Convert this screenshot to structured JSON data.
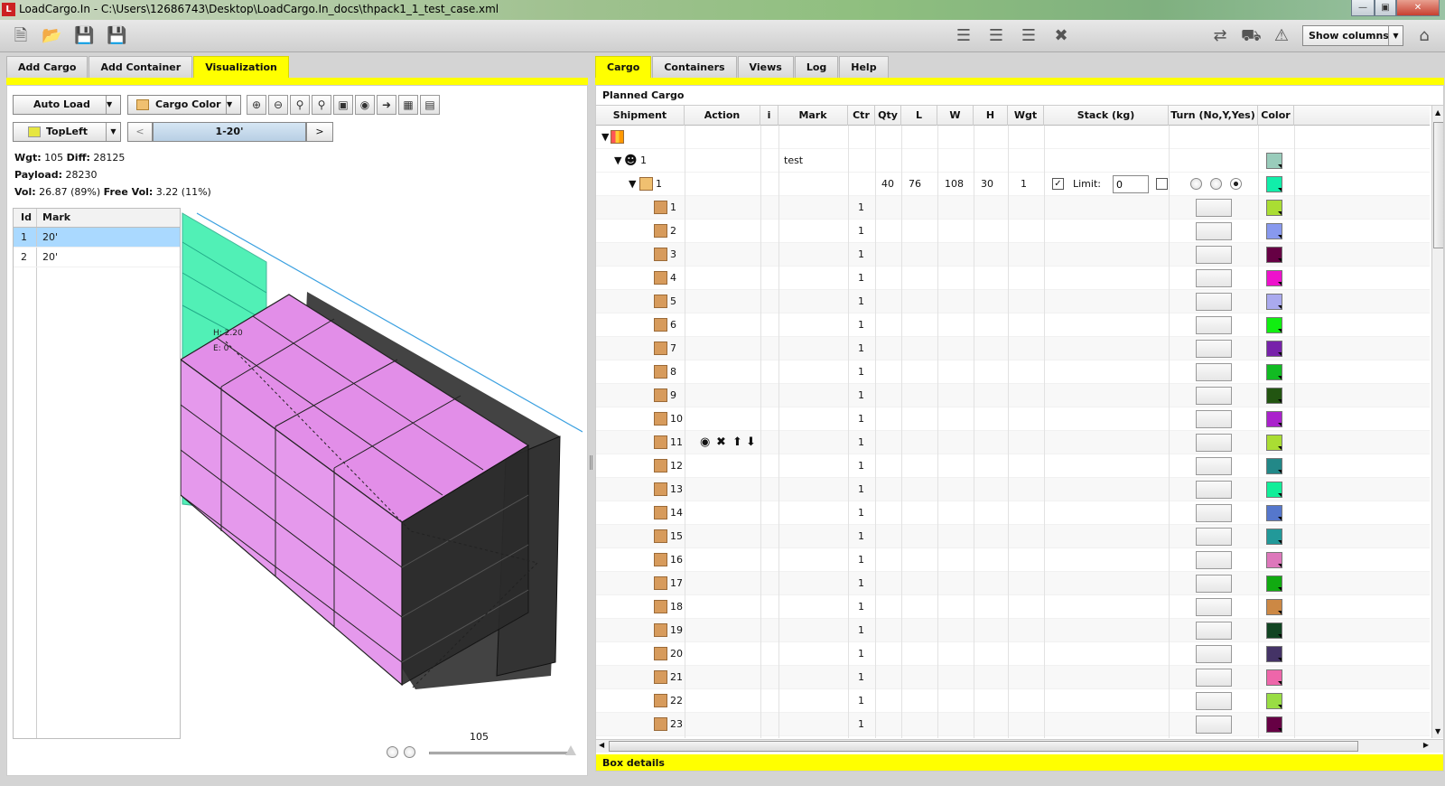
{
  "window": {
    "title": "LoadCargo.In - C:\\Users\\12686743\\Desktop\\LoadCargo.In_docs\\thpack1_1_test_case.xml",
    "app_icon": "L"
  },
  "toolbar": {
    "show_columns_label": "Show columns"
  },
  "left_tabs": [
    "Add Cargo",
    "Add Container",
    "Visualization"
  ],
  "right_tabs": [
    "Cargo",
    "Containers",
    "Views",
    "Log",
    "Help"
  ],
  "viz": {
    "auto_load_label": "Auto Load",
    "cargo_color_label": "Cargo Color",
    "view_label": "TopLeft",
    "prev_label": "<",
    "next_label": ">",
    "range_label": "1-20'",
    "wgt_label": "Wgt:",
    "wgt_value": "105",
    "diff_label": "Diff:",
    "diff_value": "28125",
    "payload_label": "Payload:",
    "payload_value": "28230",
    "vol_label": "Vol:",
    "vol_value": "26.87 (89%)",
    "free_vol_label": "Free Vol:",
    "free_vol_value": "3.22 (11%)",
    "zoom_value": "105",
    "overlay_h": "H: 2.20",
    "overlay_e": "E: 0"
  },
  "containers_table": {
    "headers": [
      "Id",
      "Mark"
    ],
    "rows": [
      {
        "id": "1",
        "mark": "20'"
      },
      {
        "id": "2",
        "mark": "20'"
      }
    ]
  },
  "cargo": {
    "planned_label": "Planned Cargo",
    "box_details_label": "Box details",
    "headers": [
      "Shipment",
      "Action",
      "i",
      "Mark",
      "Ctr",
      "Qty",
      "L",
      "W",
      "H",
      "Wgt",
      "Stack (kg)",
      "Turn (No,Y,Yes)",
      "Color"
    ],
    "shipment": {
      "id": "1",
      "mark": "test"
    },
    "group": {
      "id": "1",
      "qty": "40",
      "l": "76",
      "w": "108",
      "h": "30",
      "wgt": "1",
      "limit_label": "Limit:",
      "limit_value": "0"
    },
    "items": [
      {
        "id": "1",
        "ctr": "1",
        "color": "#aadd33"
      },
      {
        "id": "2",
        "ctr": "1",
        "color": "#8899ee"
      },
      {
        "id": "3",
        "ctr": "1",
        "color": "#660044"
      },
      {
        "id": "4",
        "ctr": "1",
        "color": "#ee11cc"
      },
      {
        "id": "5",
        "ctr": "1",
        "color": "#aaaaee"
      },
      {
        "id": "6",
        "ctr": "1",
        "color": "#11ee11"
      },
      {
        "id": "7",
        "ctr": "1",
        "color": "#7722aa"
      },
      {
        "id": "8",
        "ctr": "1",
        "color": "#11bb22"
      },
      {
        "id": "9",
        "ctr": "1",
        "color": "#225511"
      },
      {
        "id": "10",
        "ctr": "1",
        "color": "#aa22cc"
      },
      {
        "id": "11",
        "ctr": "1",
        "color": "#aadd33"
      },
      {
        "id": "12",
        "ctr": "1",
        "color": "#228888"
      },
      {
        "id": "13",
        "ctr": "1",
        "color": "#11ee99"
      },
      {
        "id": "14",
        "ctr": "1",
        "color": "#5577cc"
      },
      {
        "id": "15",
        "ctr": "1",
        "color": "#229999"
      },
      {
        "id": "16",
        "ctr": "1",
        "color": "#dd77bb"
      },
      {
        "id": "17",
        "ctr": "1",
        "color": "#11aa11"
      },
      {
        "id": "18",
        "ctr": "1",
        "color": "#cc8844"
      },
      {
        "id": "19",
        "ctr": "1",
        "color": "#114422"
      },
      {
        "id": "20",
        "ctr": "1",
        "color": "#443366"
      },
      {
        "id": "21",
        "ctr": "1",
        "color": "#ee66aa"
      },
      {
        "id": "22",
        "ctr": "1",
        "color": "#99dd44"
      },
      {
        "id": "23",
        "ctr": "1",
        "color": "#660044"
      }
    ],
    "shipment_color": "#99ccbb",
    "group_color": "#11eeaa"
  }
}
